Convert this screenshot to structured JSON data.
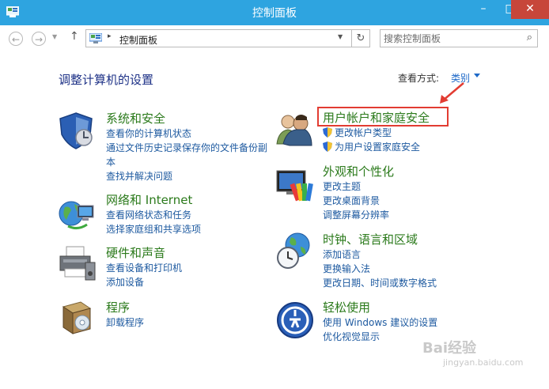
{
  "window": {
    "title": "控制面板",
    "minimize": "–",
    "maximize": "□",
    "close": "✕"
  },
  "nav": {
    "back": "←",
    "forward": "→",
    "up": "↑",
    "separator": "▸",
    "path": "控制面板",
    "refresh": "↻"
  },
  "search": {
    "placeholder": "搜索控制面板",
    "icon": "search-icon"
  },
  "main": {
    "heading": "调整计算机的设置",
    "view_label": "查看方式:",
    "view_value": "类别"
  },
  "categories": {
    "system_security": {
      "title": "系统和安全",
      "links": [
        "查看你的计算机状态",
        "通过文件历史记录保存你的文件备份副",
        "本",
        "查找并解决问题"
      ]
    },
    "network": {
      "title": "网络和 Internet",
      "links": [
        "查看网络状态和任务",
        "选择家庭组和共享选项"
      ]
    },
    "hardware": {
      "title": "硬件和声音",
      "links": [
        "查看设备和打印机",
        "添加设备"
      ]
    },
    "programs": {
      "title": "程序",
      "links": [
        "卸载程序"
      ]
    },
    "user_accounts": {
      "title": "用户帐户和家庭安全",
      "links": [
        "更改帐户类型",
        "为用户设置家庭安全"
      ]
    },
    "appearance": {
      "title": "外观和个性化",
      "links": [
        "更改主题",
        "更改桌面背景",
        "调整屏幕分辨率"
      ]
    },
    "clock": {
      "title": "时钟、语言和区域",
      "links": [
        "添加语言",
        "更换输入法",
        "更改日期、时间或数字格式"
      ]
    },
    "ease": {
      "title": "轻松使用",
      "links": [
        "使用 Windows 建议的设置",
        "优化视觉显示"
      ]
    }
  },
  "watermark": {
    "brand": "Bai经验",
    "url": "jingyan.baidu.com"
  },
  "colors": {
    "titlebar": "#2ea4e0",
    "category_title": "#2b7a1b",
    "link": "#1e5aa0",
    "heading": "#1e3287",
    "highlight": "#e23c32"
  }
}
